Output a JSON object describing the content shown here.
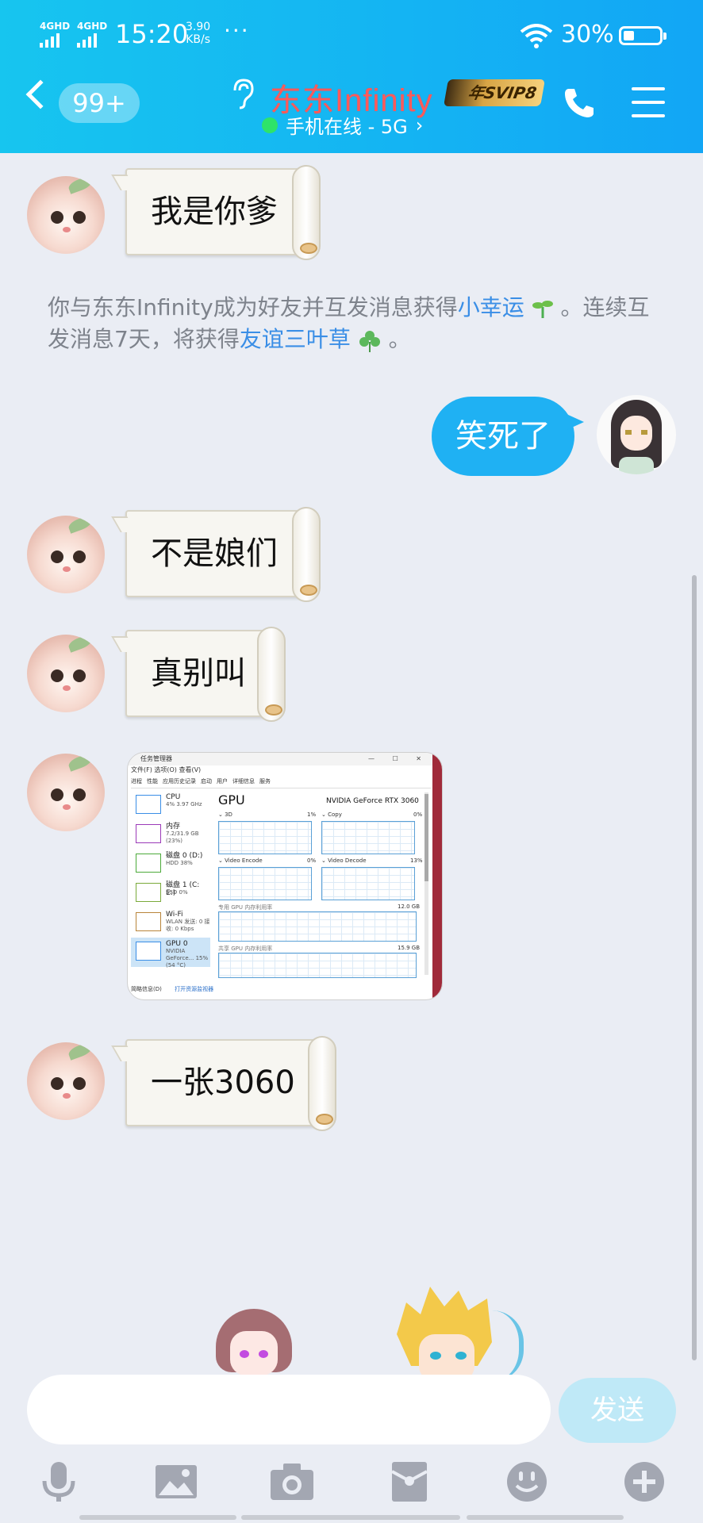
{
  "status_bar": {
    "signal1": "4GHD",
    "signal2": "4GHD",
    "time": "15:20",
    "speed_value": "3.90",
    "speed_unit": "KB/s",
    "more": "···",
    "battery": "30%",
    "battery_level": 0.3
  },
  "header": {
    "unread_count": "99+",
    "contact_name": "东东Infinity",
    "vip_badge": "年SVIP8",
    "online_status": "手机在线 - 5G",
    "chevron": "›"
  },
  "messages": [
    {
      "sender": "other",
      "text": "我是你爹"
    },
    {
      "sender": "system",
      "text_1": "你与东东Infinity成为好友并互发消息获得",
      "link_1": "小幸运",
      "text_2": "。连续互发消息7天，将获得",
      "link_2": "友谊三叶草",
      "text_3": "。"
    },
    {
      "sender": "me",
      "text": "笑死了"
    },
    {
      "sender": "other",
      "text": "不是娘们"
    },
    {
      "sender": "other",
      "text": "真别叫"
    },
    {
      "sender": "other",
      "type": "image"
    },
    {
      "sender": "other",
      "text": "一张3060"
    }
  ],
  "screenshot_image": {
    "title": "任务管理器",
    "window_controls": "— ☐ ✕",
    "menu": "文件(F)  选项(O)  查看(V)",
    "tabs": [
      "进程",
      "性能",
      "应用历史记录",
      "启动",
      "用户",
      "详细信息",
      "服务"
    ],
    "sidebar": [
      {
        "label": "CPU",
        "sub": "4% 3.97 GHz"
      },
      {
        "label": "内存",
        "sub": "7.2/31.9 GB (23%)"
      },
      {
        "label": "磁盘 0 (D:)",
        "sub": "HDD 38%"
      },
      {
        "label": "磁盘 1 (C: E:)",
        "sub": "SSD 0%"
      },
      {
        "label": "Wi-Fi",
        "sub": "WLAN 发送: 0 接收: 0 Kbps"
      },
      {
        "label": "GPU 0",
        "sub": "NVIDIA GeForce... 15% (54 °C)"
      }
    ],
    "gpu_heading": "GPU",
    "gpu_name": "NVIDIA GeForce RTX 3060",
    "graphs": [
      {
        "label": "3D",
        "value": "1%"
      },
      {
        "label": "Copy",
        "value": "0%"
      },
      {
        "label": "Video Encode",
        "value": "0%"
      },
      {
        "label": "Video Decode",
        "value": "13%"
      }
    ],
    "dedicated_label": "专用 GPU 内存利用率",
    "dedicated_value": "12.0 GB",
    "shared_label": "共享 GPU 内存利用率",
    "shared_value": "15.9 GB",
    "footer_left": "简略信息(D)",
    "footer_link": "打开资源监视器"
  },
  "input": {
    "placeholder": "",
    "send_label": "发送"
  },
  "toolbar": [
    "microphone-icon",
    "image-icon",
    "camera-icon",
    "red-packet-icon",
    "emoji-icon",
    "plus-icon"
  ]
}
